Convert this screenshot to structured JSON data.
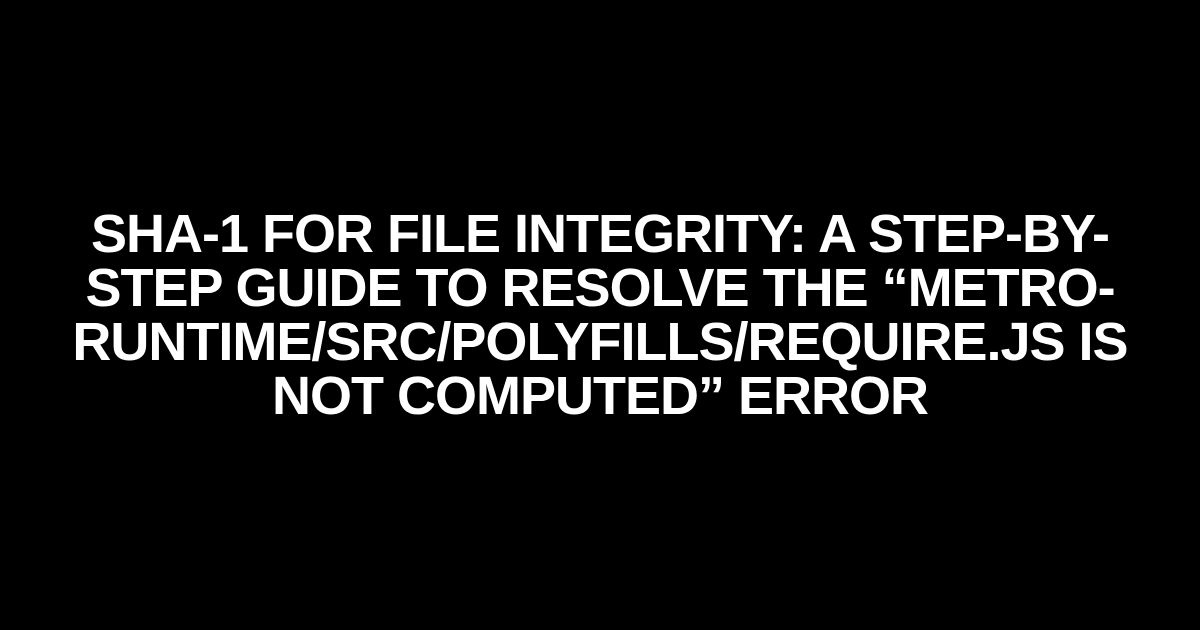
{
  "heading": {
    "text": "SHA-1 for File Integrity: A Step-by-Step Guide to Resolve the “metro-runtime/src/polyfills/require.js is not computed” Error"
  }
}
